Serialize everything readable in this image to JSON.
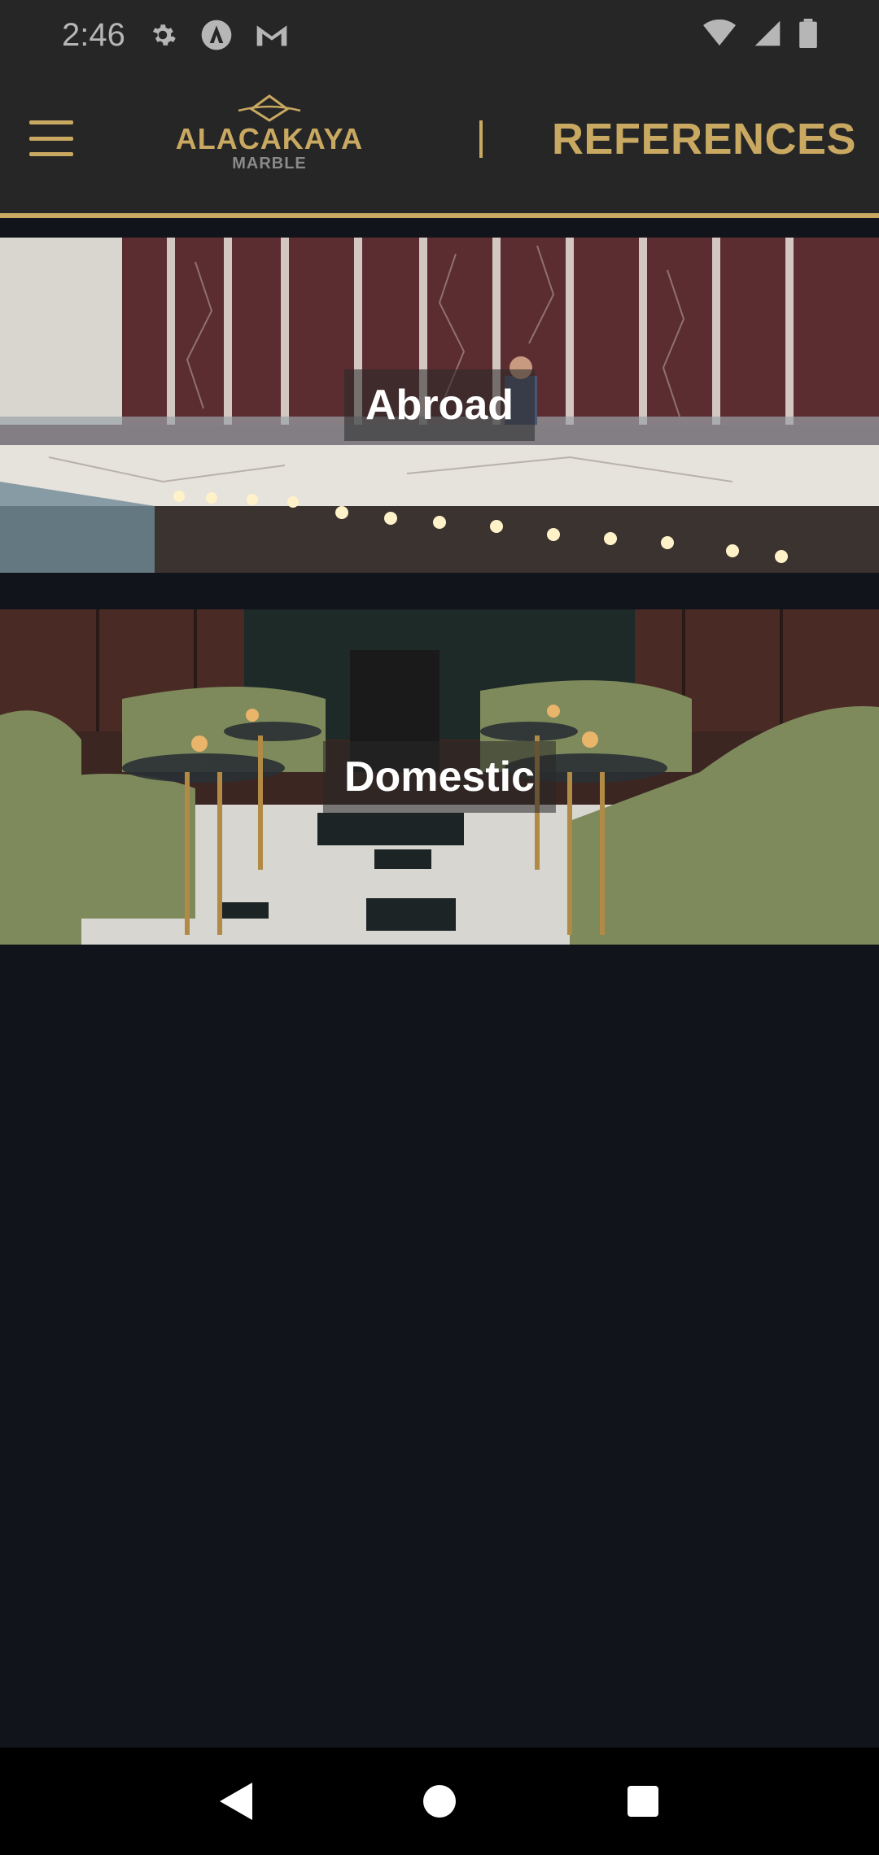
{
  "status_bar": {
    "time": "2:46",
    "icons": [
      "settings-icon",
      "a-logo-icon",
      "gmail-icon",
      "wifi-icon",
      "signal-icon",
      "battery-icon"
    ]
  },
  "app_bar": {
    "brand_name": "ALACAKAYA",
    "brand_sub": "MARBLE",
    "registered": "®",
    "title": "REFERENCES",
    "accent_color": "#c9a961"
  },
  "cards": [
    {
      "label": "Abroad"
    },
    {
      "label": "Domestic"
    }
  ],
  "nav_bar": {
    "icons": [
      "back-icon",
      "home-icon",
      "recents-icon"
    ]
  }
}
